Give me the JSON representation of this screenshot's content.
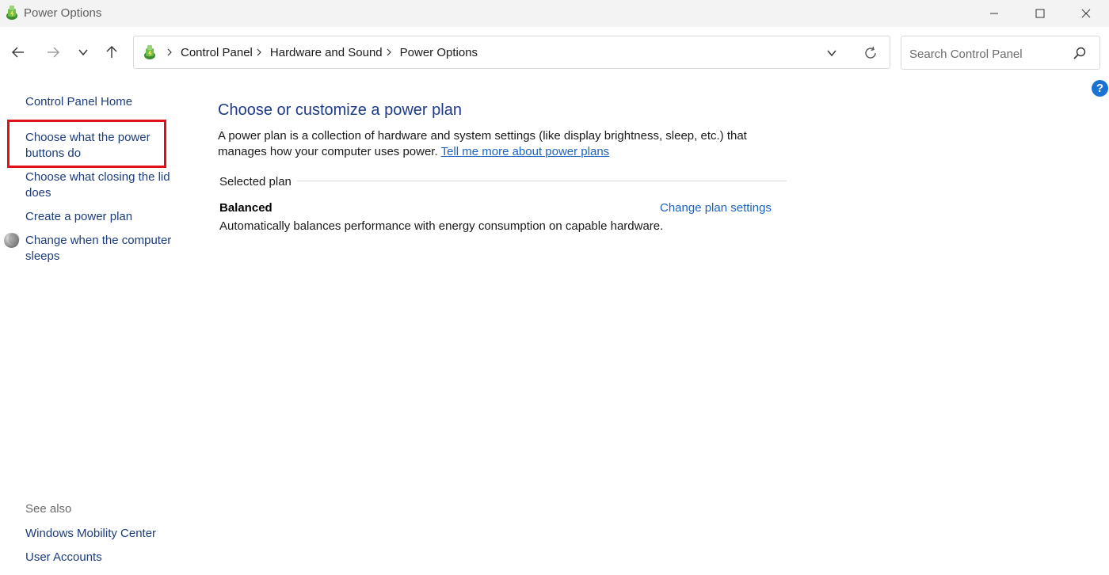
{
  "window": {
    "title": "Power Options"
  },
  "address": {
    "crumbs": [
      "Control Panel",
      "Hardware and Sound",
      "Power Options"
    ]
  },
  "search": {
    "placeholder": "Search Control Panel"
  },
  "help": {
    "glyph": "?"
  },
  "sidebar": {
    "home": "Control Panel Home",
    "tasks": [
      "Choose what the power buttons do",
      "Choose what closing the lid does",
      "Create a power plan",
      "Change when the computer sleeps"
    ],
    "see_also_heading": "See also",
    "see_also": [
      "Windows Mobility Center",
      "User Accounts"
    ]
  },
  "main": {
    "title": "Choose or customize a power plan",
    "description": "A power plan is a collection of hardware and system settings (like display brightness, sleep, etc.) that manages how your computer uses power.",
    "learn_more": "Tell me more about power plans",
    "selected_plan_label": "Selected plan",
    "plan": {
      "name": "Balanced",
      "change_link": "Change plan settings",
      "description": "Automatically balances performance with energy consumption on capable hardware."
    }
  },
  "colors": {
    "accent": "#1a64c4",
    "link": "#1d3c7a",
    "highlight": "#e1111c"
  },
  "icons": {
    "window": "power-options-icon",
    "address": "power-options-icon",
    "sleep": "moon-icon"
  }
}
